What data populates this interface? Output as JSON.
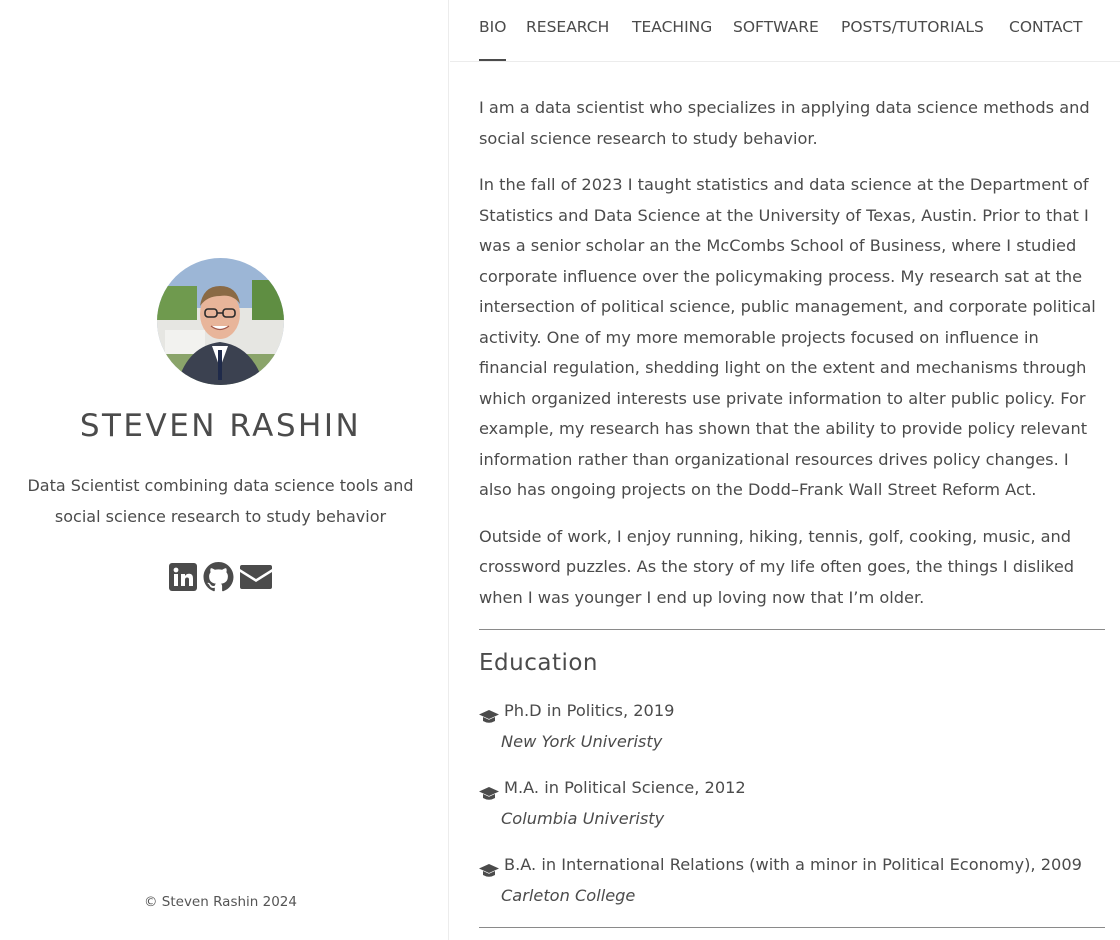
{
  "sidebar": {
    "name": "STEVEN RASHIN",
    "tagline": "Data Scientist combining data science tools and social science research to study behavior",
    "social": [
      {
        "icon": "linkedin-icon"
      },
      {
        "icon": "github-icon"
      },
      {
        "icon": "envelope-icon"
      }
    ],
    "footer": "© Steven Rashin 2024"
  },
  "nav": {
    "items": [
      {
        "label": "BIO",
        "active": true
      },
      {
        "label": "RESEARCH"
      },
      {
        "label": "TEACHING"
      },
      {
        "label": "SOFTWARE"
      },
      {
        "label": "POSTS/TUTORIALS"
      },
      {
        "label": "CONTACT"
      }
    ]
  },
  "bio": {
    "paragraphs": [
      "I am a data scientist who specializes in applying data science methods and social science research to study behavior.",
      "In the fall of 2023 I taught statistics and data science at the Department of Statistics and Data Science at the University of Texas, Austin. Prior to that I was a senior scholar an the McCombs School of Business, where I studied corporate influence over the policymaking process. My research sat at the intersection of political science, public management, and corporate political activity. One of my more memorable projects focused on influence in financial regulation, shedding light on the extent and mechanisms through which organized interests use private information to alter public policy. For example, my research has shown that the ability to provide policy relevant information rather than organizational resources drives policy changes. I also has ongoing projects on the Dodd–Frank Wall Street Reform Act.",
      "Outside of work, I enjoy running, hiking, tennis, golf, cooking, music, and crossword puzzles. As the story of my life often goes, the things I disliked when I was younger I end up loving now that I’m older."
    ]
  },
  "education": {
    "title": "Education",
    "items": [
      {
        "degree": "Ph.D in Politics, 2019",
        "school": "New York Univeristy",
        "icon": "graduation-cap-icon"
      },
      {
        "degree": "M.A. in Political Science, 2012",
        "school": "Columbia Univeristy",
        "icon": "graduation-cap-icon"
      },
      {
        "degree": "B.A. in International Relations (with a minor in Political Economy), 2009",
        "school": "Carleton College",
        "icon": "graduation-cap-icon"
      }
    ]
  }
}
